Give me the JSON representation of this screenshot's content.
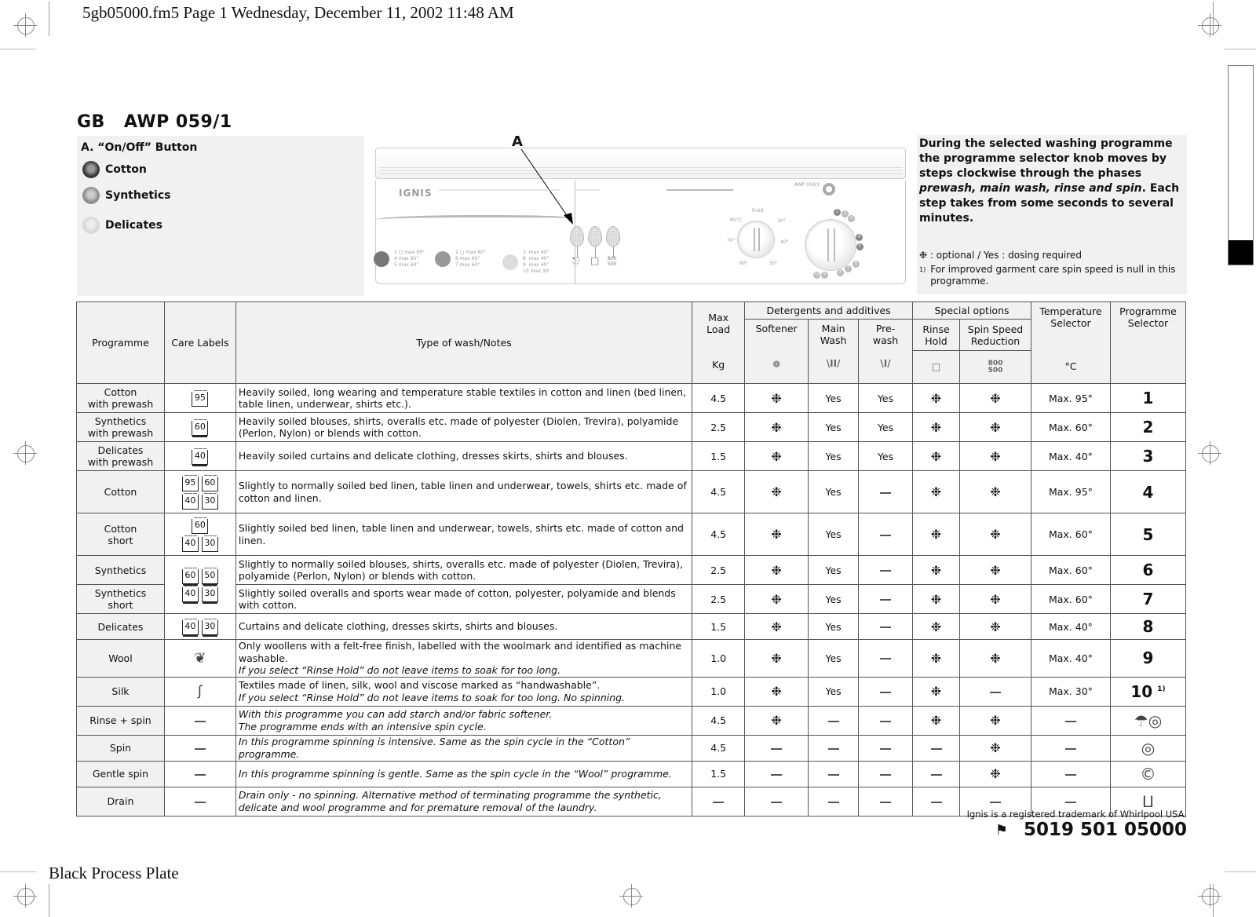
{
  "print_header": "5gb05000.fm5  Page 1  Wednesday, December 11, 2002  11:48 AM",
  "print_footer": "Black Process Plate",
  "title": {
    "region": "GB",
    "model": "AWP  059/1"
  },
  "legend": {
    "heading": "A. “On/Off” Button",
    "items": [
      {
        "icon": "cotton-icon",
        "label": "Cotton"
      },
      {
        "icon": "synthetics-icon",
        "label": "Synthetics"
      },
      {
        "icon": "delicates-icon",
        "label": "Delicates"
      }
    ]
  },
  "panel": {
    "callout": "A",
    "brand": "IGNIS",
    "model_label": "AWP 059/1",
    "spin_label_top": "800",
    "spin_label_bottom": "500",
    "groups": [
      {
        "lines": "1 □ max 95°\n4 max 95°\n5 max 60°"
      },
      {
        "lines": "2 □ max 60°\n6 max 60°\n7 max 60°"
      },
      {
        "lines": "3  max 40°\n8  max 40°\n9  max 40°\n10 max 30°"
      }
    ],
    "temp_ticks": [
      "Froid",
      "30°",
      "40°",
      "50°",
      "60°",
      "70°",
      "95°C"
    ]
  },
  "info": {
    "text_parts": [
      "During the selected washing programme the programme selector knob moves by steps clockwise through the phases ",
      "prewash, main wash, rinse and spin",
      ". Each step takes from some seconds to several minutes."
    ],
    "legend_note": "❉ : optional / Yes : dosing required",
    "footnote_mark": "1)",
    "footnote": "For improved garment care spin speed is null in this programme."
  },
  "table": {
    "headers": {
      "programme": "Programme",
      "care_labels": "Care Labels",
      "notes": "Type of wash/Notes",
      "max_load": "Max Load",
      "max_load_unit": "Kg",
      "detergents_group": "Detergents and additives",
      "softener": "Softener",
      "main_wash": "Main Wash",
      "prewash": "Pre-wash",
      "special_group": "Special options",
      "rinse_hold": "Rinse Hold",
      "spin_reduction": "Spin Speed Reduction",
      "spin_icon_top": "800",
      "spin_icon_bottom": "500",
      "temperature": "Temperature Selector",
      "temperature_unit": "°C",
      "programme_selector": "Programme Selector"
    },
    "rows": [
      {
        "programme": "Cotton\nwith prewash",
        "care": [
          [
            "95"
          ]
        ],
        "care_style": "",
        "notes": "Heavily soiled, long wearing and temperature stable textiles in cotton and linen (bed linen, table linen, underwear, shirts etc.).",
        "notes_italic": "",
        "load": "4.5",
        "softener": "❉",
        "main": "Yes",
        "prewash": "Yes",
        "rinse_hold": "❉",
        "spin": "❉",
        "temp": "Max. 95°",
        "selector": "1",
        "selector_sup": ""
      },
      {
        "programme": "Synthetics\nwith prewash",
        "care": [
          [
            "60"
          ]
        ],
        "care_style": "bar1",
        "notes": "Heavily soiled blouses, shirts, overalls etc. made of polyester (Diolen, Trevira), polyamide (Perlon, Nylon) or blends with cotton.",
        "notes_italic": "",
        "load": "2.5",
        "softener": "❉",
        "main": "Yes",
        "prewash": "Yes",
        "rinse_hold": "❉",
        "spin": "❉",
        "temp": "Max. 60°",
        "selector": "2",
        "selector_sup": ""
      },
      {
        "programme": "Delicates\nwith prewash",
        "care": [
          [
            "40"
          ]
        ],
        "care_style": "bar2",
        "notes": "Heavily soiled curtains and delicate clothing, dresses skirts, shirts and blouses.",
        "notes_italic": "",
        "load": "1.5",
        "softener": "❉",
        "main": "Yes",
        "prewash": "Yes",
        "rinse_hold": "❉",
        "spin": "❉",
        "temp": "Max. 40°",
        "selector": "3",
        "selector_sup": ""
      },
      {
        "programme": "Cotton",
        "care": [
          [
            "95",
            "60"
          ],
          [
            "40",
            "30"
          ]
        ],
        "care_style": "",
        "notes": "Slightly to normally soiled bed linen, table linen and underwear, towels, shirts etc. made of cotton and linen.",
        "notes_italic": "",
        "load": "4.5",
        "softener": "❉",
        "main": "Yes",
        "prewash": "—",
        "rinse_hold": "❉",
        "spin": "❉",
        "temp": "Max. 95°",
        "selector": "4",
        "selector_sup": ""
      },
      {
        "programme": "Cotton\nshort",
        "care": [
          [
            "60"
          ],
          [
            "40",
            "30"
          ]
        ],
        "care_style": "",
        "notes": "Slightly soiled bed linen, table linen and underwear, towels, shirts etc. made of cotton and linen.",
        "notes_italic": "",
        "load": "4.5",
        "softener": "❉",
        "main": "Yes",
        "prewash": "—",
        "rinse_hold": "❉",
        "spin": "❉",
        "temp": "Max. 60°",
        "selector": "5",
        "selector_sup": ""
      },
      {
        "programme": "Synthetics",
        "care": [
          [
            "60",
            "50"
          ],
          [
            "40",
            "30"
          ]
        ],
        "care_style": "bar1",
        "notes": "Slightly to normally soiled blouses, shirts, overalls etc. made of polyester (Diolen, Trevira), polyamide (Perlon, Nylon) or blends with cotton.",
        "notes_italic": "",
        "load": "2.5",
        "softener": "❉",
        "main": "Yes",
        "prewash": "—",
        "rinse_hold": "❉",
        "spin": "❉",
        "temp": "Max. 60°",
        "selector": "6",
        "selector_sup": ""
      },
      {
        "programme": "Synthetics\nshort",
        "care": [],
        "care_style": "",
        "notes": "Slightly soiled overalls and sports wear made of cotton, polyester, polyamide and blends with cotton.",
        "notes_italic": "",
        "load": "2.5",
        "softener": "❉",
        "main": "Yes",
        "prewash": "—",
        "rinse_hold": "❉",
        "spin": "❉",
        "temp": "Max. 60°",
        "selector": "7",
        "selector_sup": ""
      },
      {
        "programme": "Delicates",
        "care": [
          [
            "40",
            "30"
          ]
        ],
        "care_style": "bar2",
        "notes": "Curtains and delicate clothing, dresses skirts, shirts and blouses.",
        "notes_italic": "",
        "load": "1.5",
        "softener": "❉",
        "main": "Yes",
        "prewash": "—",
        "rinse_hold": "❉",
        "spin": "❉",
        "temp": "Max. 40°",
        "selector": "8",
        "selector_sup": ""
      },
      {
        "programme": "Wool",
        "care_icon": "woolmark-icon",
        "care": [],
        "care_style": "",
        "notes": "Only woollens with a felt-free finish, labelled with the woolmark and identified as machine washable.",
        "notes_italic": "If you select “Rinse Hold” do not leave items to soak for too long.",
        "load": "1.0",
        "softener": "❉",
        "main": "Yes",
        "prewash": "—",
        "rinse_hold": "❉",
        "spin": "❉",
        "temp": "Max. 40°",
        "selector": "9",
        "selector_sup": ""
      },
      {
        "programme": "Silk",
        "care_icon": "silk-icon",
        "care": [],
        "care_style": "",
        "notes": "Textiles made of linen, silk, wool and viscose marked as “handwashable”.",
        "notes_italic": "If you select “Rinse Hold” do not leave items to soak for too long. No spinning.",
        "load": "1.0",
        "softener": "❉",
        "main": "Yes",
        "prewash": "—",
        "rinse_hold": "❉",
        "spin": "—",
        "temp": "Max. 30°",
        "selector": "10",
        "selector_sup": "1)"
      },
      {
        "programme": "Rinse + spin",
        "care_dash": "—",
        "care": [],
        "care_style": "",
        "notes": "",
        "notes_italic": "With this programme you can add starch and/or fabric softener.\nThe programme ends with an intensive spin cycle.",
        "load": "4.5",
        "softener": "❉",
        "main": "—",
        "prewash": "—",
        "rinse_hold": "❉",
        "spin": "❉",
        "temp": "—",
        "selector_icon": "rinse-spin-icon",
        "selector": "",
        "selector_sup": ""
      },
      {
        "programme": "Spin",
        "care_dash": "—",
        "care": [],
        "care_style": "",
        "notes": "",
        "notes_italic": "In this programme spinning is intensive. Same as the spin cycle in the “Cotton” programme.",
        "load": "4.5",
        "softener": "—",
        "main": "—",
        "prewash": "—",
        "rinse_hold": "—",
        "spin": "❉",
        "temp": "—",
        "selector_icon": "spin-icon",
        "selector": "",
        "selector_sup": ""
      },
      {
        "programme": "Gentle spin",
        "care_dash": "—",
        "care": [],
        "care_style": "",
        "notes": "",
        "notes_italic": "In this programme spinning is gentle. Same as the spin cycle in the “Wool” programme.",
        "load": "1.5",
        "softener": "—",
        "main": "—",
        "prewash": "—",
        "rinse_hold": "—",
        "spin": "❉",
        "temp": "—",
        "selector_icon": "gentle-spin-icon",
        "selector": "",
        "selector_sup": ""
      },
      {
        "programme": "Drain",
        "care_dash": "—",
        "care": [],
        "care_style": "",
        "notes": "",
        "notes_italic": "Drain only - no spinning. Alternative method of terminating programme the synthetic, delicate and wool programme and for premature removal of the laundry.",
        "load": "—",
        "softener": "—",
        "main": "—",
        "prewash": "—",
        "rinse_hold": "—",
        "spin": "—",
        "temp": "—",
        "selector_icon": "drain-icon",
        "selector": "",
        "selector_sup": ""
      }
    ]
  },
  "footer": {
    "trademark": "Ignis is a registered trademark of Whirlpool USA.",
    "part_number": "5019 501 05000"
  }
}
